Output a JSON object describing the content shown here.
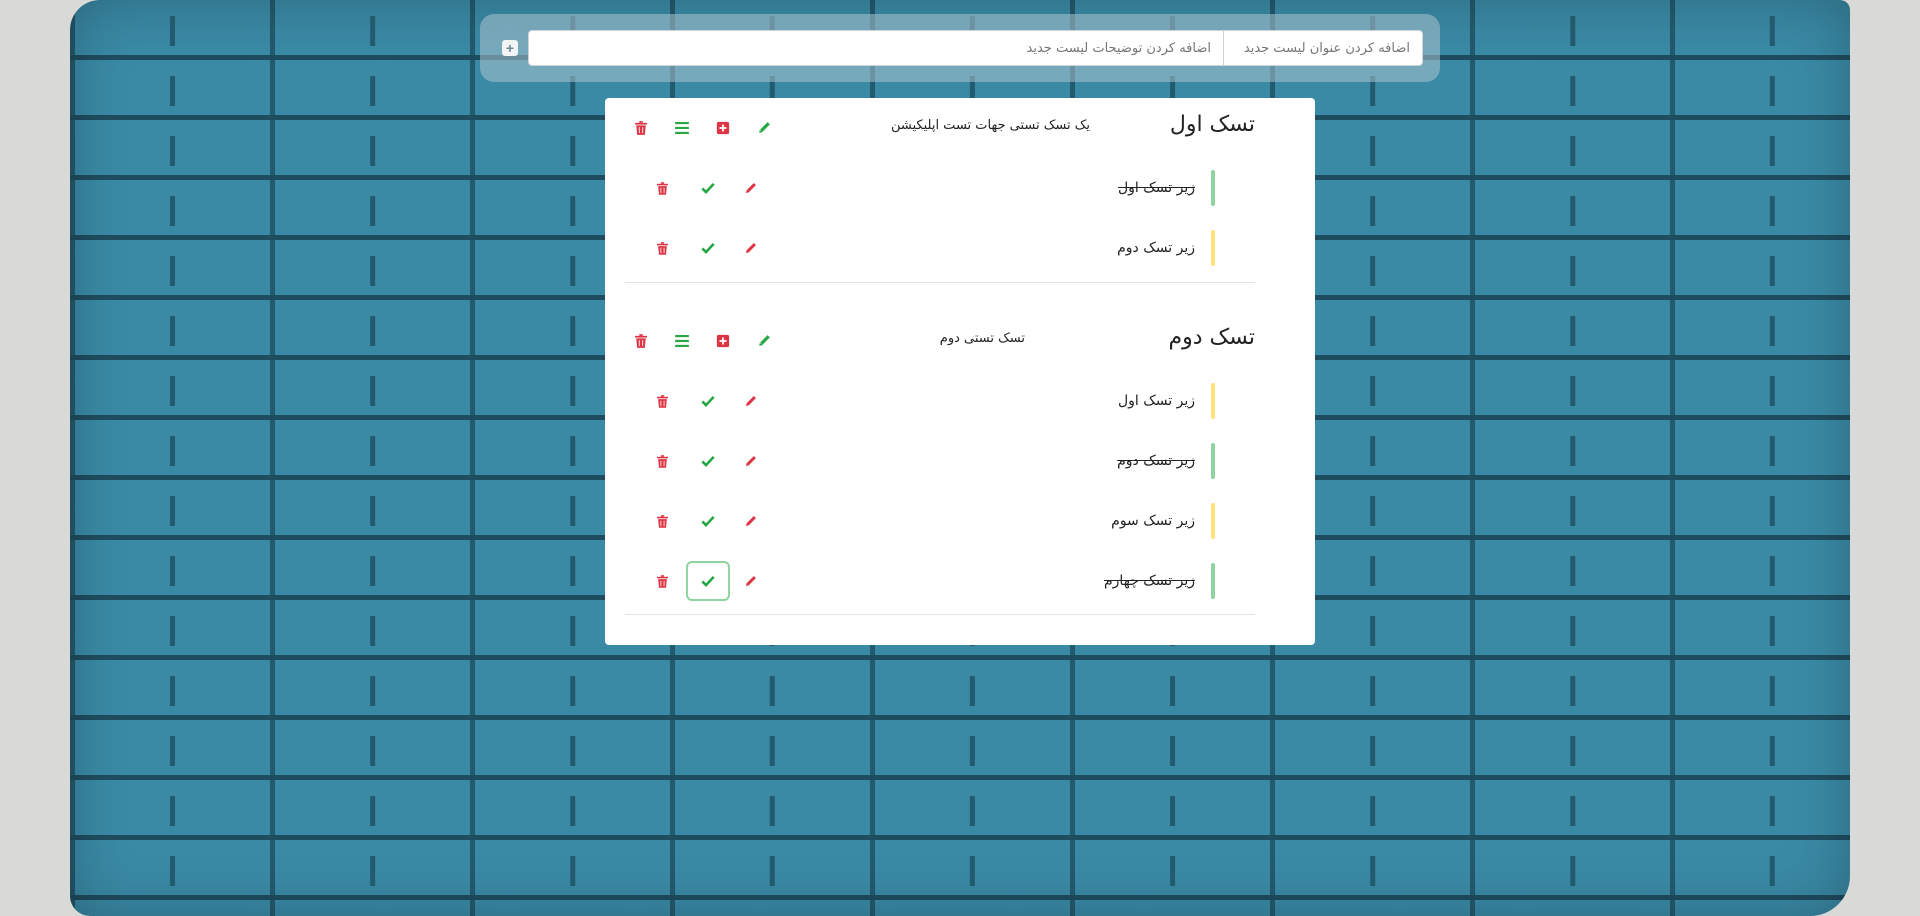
{
  "top_bar": {
    "title_placeholder": "اضافه کردن عنوان لیست جدید",
    "description_placeholder": "اضافه کردن توضیحات لیست جدید",
    "add_icon": "plus-square-icon"
  },
  "colors": {
    "green": "#28a745",
    "red": "#dc3545",
    "yellow": "#ffc107",
    "green_bar": "#8fd3a0",
    "yellow_bar": "#ffe27a"
  },
  "tasks": [
    {
      "title": "تسک اول",
      "description": "یک تسک تستی جهات تست اپلیکیشن",
      "actions": [
        "edit-icon",
        "plus-square-icon",
        "list-icon",
        "trash-icon"
      ],
      "subtasks": [
        {
          "label": "زیر تسک اول",
          "status": "done"
        },
        {
          "label": "زیر تسک دوم",
          "status": "pending"
        }
      ]
    },
    {
      "title": "تسک دوم",
      "description": "تسک تستی دوم",
      "actions": [
        "edit-icon",
        "plus-square-icon",
        "list-icon",
        "trash-icon"
      ],
      "subtasks": [
        {
          "label": "زیر تسک اول",
          "status": "pending"
        },
        {
          "label": "زیر تسک دوم",
          "status": "done"
        },
        {
          "label": "زیر تسک سوم",
          "status": "pending"
        },
        {
          "label": "زیر تسک چهارم",
          "status": "done"
        }
      ]
    }
  ]
}
